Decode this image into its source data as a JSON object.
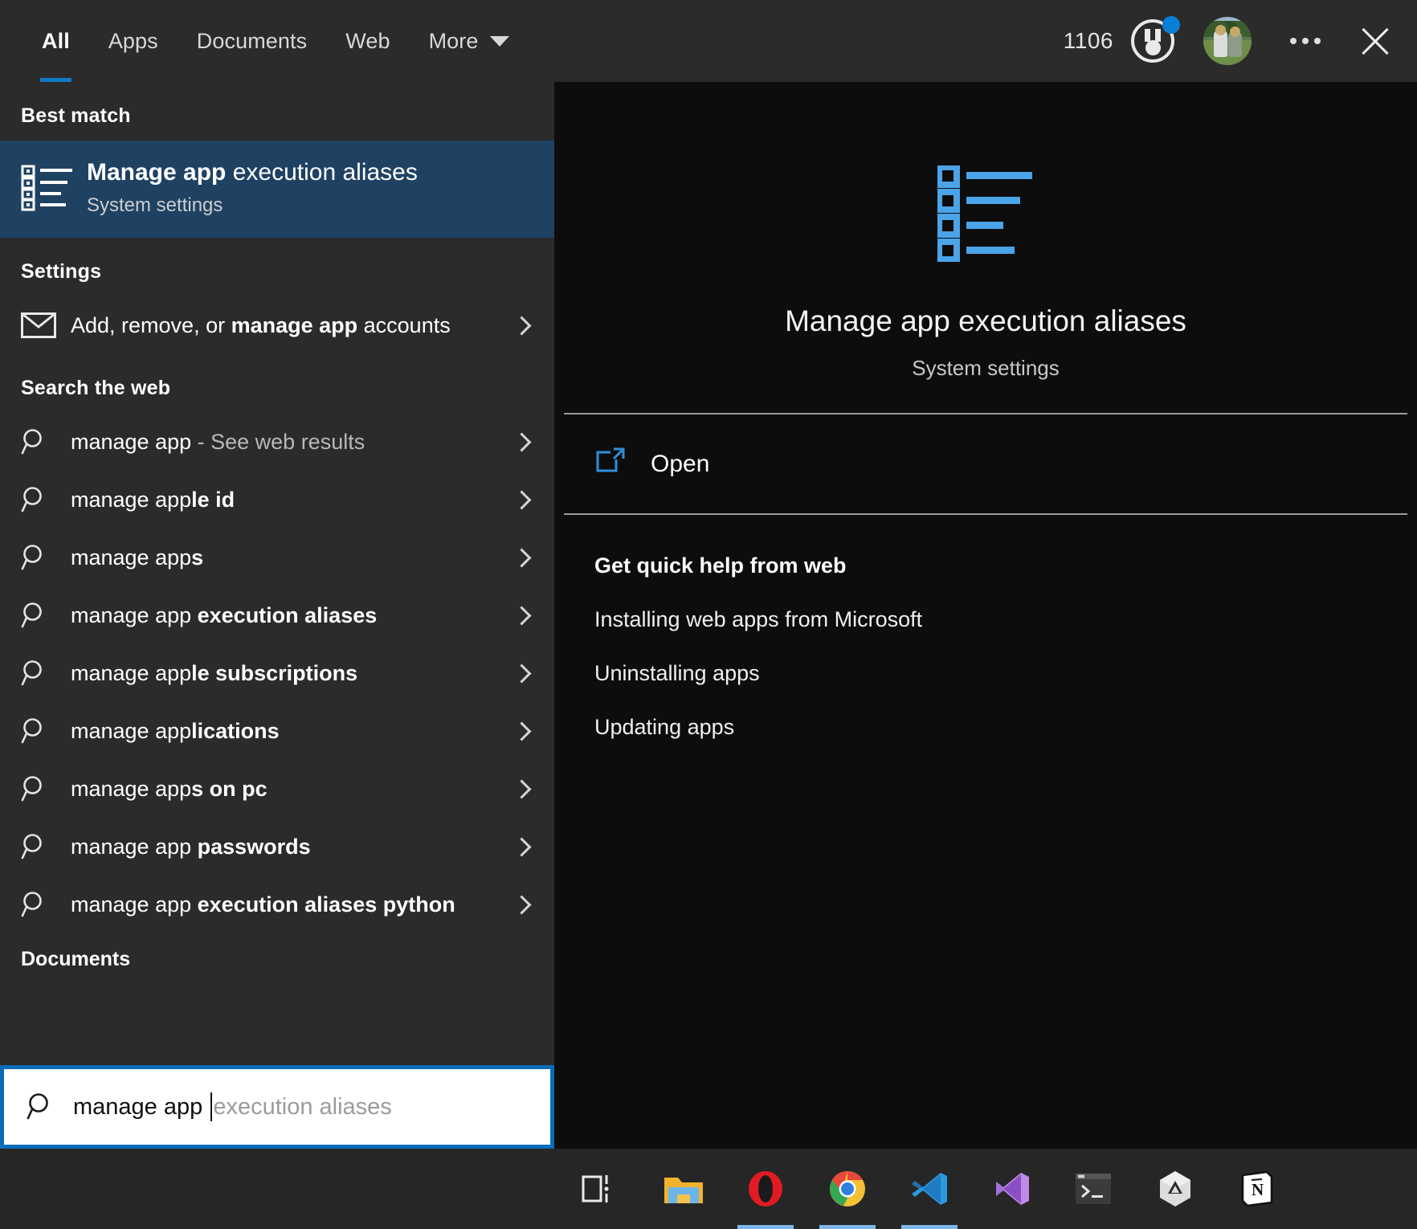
{
  "header": {
    "tabs": [
      {
        "label": "All",
        "active": true
      },
      {
        "label": "Apps",
        "active": false
      },
      {
        "label": "Documents",
        "active": false
      },
      {
        "label": "Web",
        "active": false
      },
      {
        "label": "More",
        "active": false,
        "has_caret": true
      }
    ],
    "rewards_count": "1106",
    "rewards_icon": "rewards-medal-icon",
    "rewards_badge_color": "#0a7fd6",
    "avatar": "user-avatar-photo",
    "more_options": "ellipsis-icon",
    "close": "close-icon",
    "accent_color": "#0f7bc4"
  },
  "left_pane": {
    "best_match_header": "Best match",
    "best_match": {
      "icon": "app-execution-aliases-list-icon",
      "title_bold": "Manage app",
      "title_rest": " execution aliases",
      "subtitle": "System settings"
    },
    "settings_header": "Settings",
    "settings_items": [
      {
        "icon": "mail-envelope-icon",
        "prefix": "Add, remove, or ",
        "bold": "manage app",
        "suffix": " accounts",
        "chevron": "chevron-right-icon"
      }
    ],
    "web_header": "Search the web",
    "web_items": [
      {
        "icon": "search-icon",
        "normal": "manage app",
        "bold": "",
        "dim": " - See web results",
        "chevron": "chevron-right-icon"
      },
      {
        "icon": "search-icon",
        "normal": "manage app",
        "bold": "le id",
        "dim": "",
        "chevron": "chevron-right-icon"
      },
      {
        "icon": "search-icon",
        "normal": "manage app",
        "bold": "s",
        "dim": "",
        "chevron": "chevron-right-icon"
      },
      {
        "icon": "search-icon",
        "normal": "manage app",
        "bold": " execution aliases",
        "dim": "",
        "chevron": "chevron-right-icon"
      },
      {
        "icon": "search-icon",
        "normal": "manage app",
        "bold": "le subscriptions",
        "dim": "",
        "chevron": "chevron-right-icon"
      },
      {
        "icon": "search-icon",
        "normal": "manage app",
        "bold": "lications",
        "dim": "",
        "chevron": "chevron-right-icon"
      },
      {
        "icon": "search-icon",
        "normal": "manage app",
        "bold": "s on pc",
        "dim": "",
        "chevron": "chevron-right-icon"
      },
      {
        "icon": "search-icon",
        "normal": "manage app",
        "bold": " passwords",
        "dim": "",
        "chevron": "chevron-right-icon"
      },
      {
        "icon": "search-icon",
        "normal": "manage app",
        "bold": " execution aliases python",
        "dim": "",
        "chevron": "chevron-right-icon"
      }
    ],
    "documents_header": "Documents"
  },
  "preview_pane": {
    "icon": "app-execution-aliases-list-icon-large",
    "icon_color": "#4ba3e8",
    "title": "Manage app execution aliases",
    "subtitle": "System settings",
    "open_action": {
      "icon": "external-link-icon",
      "label": "Open",
      "icon_color": "#2f8fdc"
    },
    "help_header": "Get quick help from web",
    "help_links": [
      "Installing web apps from Microsoft",
      "Uninstalling apps",
      "Updating apps"
    ]
  },
  "search_bar": {
    "icon": "search-icon",
    "typed_value": "manage app ",
    "autocomplete_suggestion": "execution aliases",
    "border_color": "#0b6cb8"
  },
  "taskbar": {
    "items": [
      {
        "name": "task-view-icon",
        "label": "Task View",
        "active": false
      },
      {
        "name": "file-explorer-icon",
        "label": "File Explorer",
        "active": false
      },
      {
        "name": "opera-icon",
        "label": "Opera",
        "active": true
      },
      {
        "name": "chrome-icon",
        "label": "Google Chrome",
        "active": true
      },
      {
        "name": "vscode-icon",
        "label": "Visual Studio Code",
        "active": true
      },
      {
        "name": "visual-studio-icon",
        "label": "Visual Studio",
        "active": false
      },
      {
        "name": "terminal-icon",
        "label": "Terminal",
        "active": false
      },
      {
        "name": "unity-icon",
        "label": "Unity",
        "active": false
      },
      {
        "name": "notion-icon",
        "label": "Notion",
        "active": false
      }
    ]
  }
}
